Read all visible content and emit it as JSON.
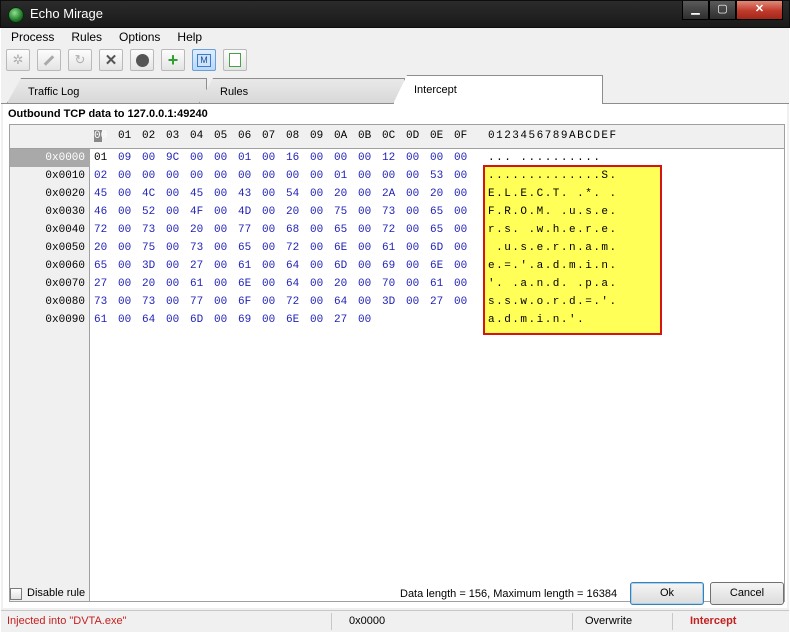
{
  "window": {
    "title": "Echo Mirage"
  },
  "menu": [
    "Process",
    "Rules",
    "Options",
    "Help"
  ],
  "toolbar": {
    "mode_label": "M"
  },
  "tabs": [
    "Traffic Log",
    "Rules",
    "Intercept"
  ],
  "header": {
    "outbound": "Outbound TCP data to 127.0.0.1:49240"
  },
  "hex": {
    "columns": [
      "00",
      "01",
      "02",
      "03",
      "04",
      "05",
      "06",
      "07",
      "08",
      "09",
      "0A",
      "0B",
      "0C",
      "0D",
      "0E",
      "0F"
    ],
    "ascii_header": "0123456789ABCDEF",
    "rows": [
      {
        "addr": "0x0000",
        "bytes": [
          "01",
          "09",
          "00",
          "9C",
          "00",
          "00",
          "01",
          "00",
          "16",
          "00",
          "00",
          "00",
          "12",
          "00",
          "00",
          "00"
        ],
        "ascii": "... .........."
      },
      {
        "addr": "0x0010",
        "bytes": [
          "02",
          "00",
          "00",
          "00",
          "00",
          "00",
          "00",
          "00",
          "00",
          "00",
          "01",
          "00",
          "00",
          "00",
          "53",
          "00"
        ],
        "ascii": "..............S."
      },
      {
        "addr": "0x0020",
        "bytes": [
          "45",
          "00",
          "4C",
          "00",
          "45",
          "00",
          "43",
          "00",
          "54",
          "00",
          "20",
          "00",
          "2A",
          "00",
          "20",
          "00"
        ],
        "ascii": "E.L.E.C.T. .*. ."
      },
      {
        "addr": "0x0030",
        "bytes": [
          "46",
          "00",
          "52",
          "00",
          "4F",
          "00",
          "4D",
          "00",
          "20",
          "00",
          "75",
          "00",
          "73",
          "00",
          "65",
          "00"
        ],
        "ascii": "F.R.O.M. .u.s.e."
      },
      {
        "addr": "0x0040",
        "bytes": [
          "72",
          "00",
          "73",
          "00",
          "20",
          "00",
          "77",
          "00",
          "68",
          "00",
          "65",
          "00",
          "72",
          "00",
          "65",
          "00"
        ],
        "ascii": "r.s. .w.h.e.r.e."
      },
      {
        "addr": "0x0050",
        "bytes": [
          "20",
          "00",
          "75",
          "00",
          "73",
          "00",
          "65",
          "00",
          "72",
          "00",
          "6E",
          "00",
          "61",
          "00",
          "6D",
          "00"
        ],
        "ascii": " .u.s.e.r.n.a.m."
      },
      {
        "addr": "0x0060",
        "bytes": [
          "65",
          "00",
          "3D",
          "00",
          "27",
          "00",
          "61",
          "00",
          "64",
          "00",
          "6D",
          "00",
          "69",
          "00",
          "6E",
          "00"
        ],
        "ascii": "e.=.'.a.d.m.i.n."
      },
      {
        "addr": "0x0070",
        "bytes": [
          "27",
          "00",
          "20",
          "00",
          "61",
          "00",
          "6E",
          "00",
          "64",
          "00",
          "20",
          "00",
          "70",
          "00",
          "61",
          "00"
        ],
        "ascii": "'. .a.n.d. .p.a."
      },
      {
        "addr": "0x0080",
        "bytes": [
          "73",
          "00",
          "73",
          "00",
          "77",
          "00",
          "6F",
          "00",
          "72",
          "00",
          "64",
          "00",
          "3D",
          "00",
          "27",
          "00"
        ],
        "ascii": "s.s.w.o.r.d.=.'."
      },
      {
        "addr": "0x0090",
        "bytes": [
          "61",
          "00",
          "64",
          "00",
          "6D",
          "00",
          "69",
          "00",
          "6E",
          "00",
          "27",
          "00"
        ],
        "ascii": "a.d.m.i.n.'."
      }
    ]
  },
  "controls": {
    "disable_rule": "Disable rule",
    "data_length": "Data length = 156, Maximum length = 16384",
    "ok": "Ok",
    "cancel": "Cancel"
  },
  "status": {
    "injected": "Injected into \"DVTA.exe\"",
    "offset": "0x0000",
    "mode": "Overwrite",
    "state": "Intercept"
  },
  "colors": {
    "hex_text": "#1f1fb8",
    "highlight": "#ffff57",
    "highlight_border": "#d51414",
    "status_alert": "#c41f1f"
  }
}
